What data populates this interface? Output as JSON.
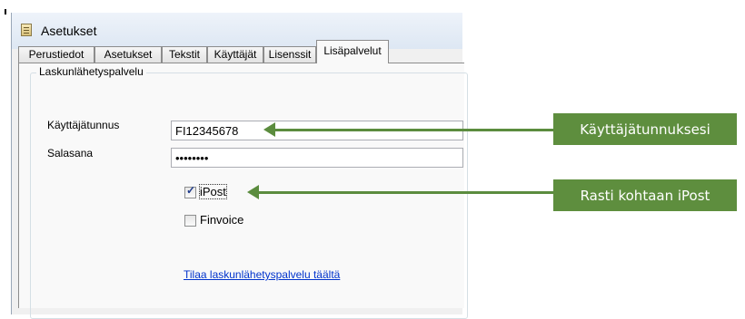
{
  "window": {
    "title": "Asetukset"
  },
  "tabs": [
    "Perustiedot",
    "Asetukset",
    "Tekstit",
    "Käyttäjät",
    "Lisenssit",
    "Lisäpalvelut"
  ],
  "active_tab": "Lisäpalvelut",
  "group": {
    "title": "Laskunlähetyspalvelu",
    "username_label": "Käyttäjätunnus",
    "username_value": "FI12345678",
    "password_label": "Salasana",
    "password_value": "••••••••",
    "ipost": {
      "label": "iPost",
      "checked": true
    },
    "finvoice": {
      "label": "Finvoice",
      "checked": false
    },
    "link": "Tilaa laskunlähetyspalvelu täältä"
  },
  "callouts": {
    "username": "Käyttäjätunnuksesi",
    "ipost": "Rasti kohtaan iPost",
    "color": "#5e8e3e"
  }
}
